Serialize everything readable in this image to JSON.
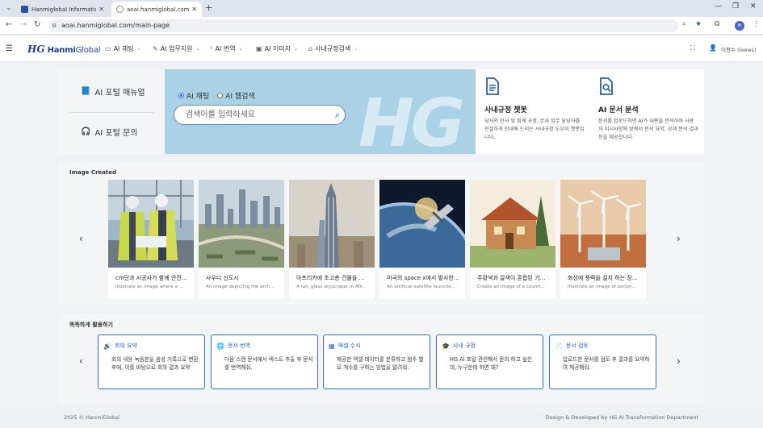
{
  "browser": {
    "tabs": [
      {
        "title": "Hanmiglobal Information Tech"
      },
      {
        "title": "aoai.hanmiglobal.com/main-p"
      }
    ],
    "url": "aoai.hanmiglobal.com/main-page",
    "profile_initial": "W"
  },
  "header": {
    "logo_mark": "HG",
    "logo_name_bold": "Hanmi",
    "logo_name_rest": "Global",
    "menu": [
      {
        "label": "AI 채팅"
      },
      {
        "label": "AI 업무지원"
      },
      {
        "label": "AI 번역"
      },
      {
        "label": "AI 이미지"
      },
      {
        "label": "사내규정검색"
      }
    ],
    "user": "이평수 (leews)"
  },
  "hero": {
    "manual_link": "AI 포털 매뉴얼",
    "inquiry_link": "AI 포털 문의",
    "radio_chat": "AI 채팅",
    "radio_web": "AI 웹검색",
    "search_placeholder": "검색어를 입력하세요",
    "watermark": "HG",
    "card1_title": "사내규정 챗봇",
    "card1_desc": "당사의 인사 및 회계 규정, 본사 업무 담당자를 친절하게 안내해 드리는 사내규정 도우미 챗봇입니다.",
    "card2_title": "AI 문서 분석",
    "card2_desc": "문서를 업로드하면 AI가 내용을 분석하여 사용자 지시사항에 맞춰서 문서 요약, 상세 분석 결과 등을 제공합니다."
  },
  "images": {
    "section_title": "Image Created",
    "items": [
      {
        "caption": "cm단과 시공사가 함께 안전 ...",
        "sub": "Illustrate an image where a ..."
      },
      {
        "caption": "사우디 신도시",
        "sub": "An image depicting the arch..."
      },
      {
        "caption": "아프리카에 초고층 건물을 유...",
        "sub": "A tall, glass skyscraper in Afri..."
      },
      {
        "caption": "미국의 space x에서 발사한 ...",
        "sub": "An artificial satellite launche..."
      },
      {
        "caption": "주황색과 갈색이 혼합된 기와...",
        "sub": "Create an image of a countr..."
      },
      {
        "caption": "화성에 풍력을 설치 하는 장비...",
        "sub": "Illustrate an image of astron..."
      }
    ]
  },
  "usecases": {
    "section_title": "똑똑하게 활용하기",
    "items": [
      {
        "title": "회의 요약",
        "icon": "speaker-icon",
        "desc": "회의 내용 녹음본을 음성 기록으로 변환 후에, 이를 바탕으로 회의 결과 요약"
      },
      {
        "title": "문서 번역",
        "icon": "globe-icon",
        "desc": "다음 스캔 문서에서 텍스트 추출 후 문서를 번역해줘."
      },
      {
        "title": "엑셀 수식",
        "icon": "table-icon",
        "desc": "제공한 엑셀 데이터를 분류하고 범주 별로 개수를 구하는 방법을 알려줘."
      },
      {
        "title": "사내 규정",
        "icon": "graduation-cap-icon",
        "desc": "HG AI 포털 관련해서 문의 하고 싶은데, 누구한테 하면 돼?"
      },
      {
        "title": "문서 검토",
        "icon": "document-icon",
        "desc": "업로드한 문서를 검토 후 결과를 요약하여 제공해줘."
      }
    ]
  },
  "footer": {
    "copyright": "2025 © HanmiGlobal",
    "credit": "Design & Developed by HG AI Transformation Department"
  },
  "colors": {
    "accent": "#2d6fd8",
    "hero_bg": "#a9d2e7",
    "brand": "#1d3e8f"
  }
}
